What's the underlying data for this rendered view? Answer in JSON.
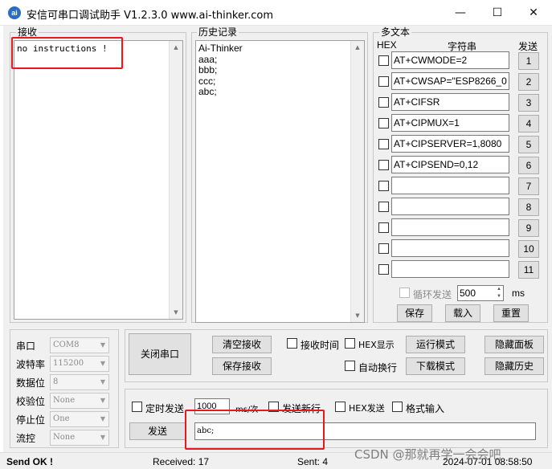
{
  "window": {
    "title": "安信可串口调试助手 V1.2.3.0     www.ai-thinker.com",
    "icon_text": "ai",
    "minimize": "—",
    "maximize": "☐",
    "close": "✕"
  },
  "receive": {
    "label": "接收",
    "text": "no instructions !"
  },
  "history": {
    "label": "历史记录",
    "lines": [
      "Ai-Thinker",
      "aaa;",
      "bbb;",
      "ccc;",
      "abc;"
    ]
  },
  "multitext": {
    "label": "多文本",
    "col_hex": "HEX",
    "col_string": "字符串",
    "col_send": "发送",
    "rows": [
      {
        "value": "AT+CWMODE=2",
        "num": "1"
      },
      {
        "value": "AT+CWSAP=\"ESP8266_0",
        "num": "2"
      },
      {
        "value": "AT+CIFSR",
        "num": "3"
      },
      {
        "value": "AT+CIPMUX=1",
        "num": "4"
      },
      {
        "value": "AT+CIPSERVER=1,8080",
        "num": "5"
      },
      {
        "value": "AT+CIPSEND=0,12",
        "num": "6"
      },
      {
        "value": "",
        "num": "7"
      },
      {
        "value": "",
        "num": "8"
      },
      {
        "value": "",
        "num": "9"
      },
      {
        "value": "",
        "num": "10"
      },
      {
        "value": "",
        "num": "11"
      }
    ],
    "loop_label": "循环发送",
    "loop_value": "500",
    "loop_unit": "ms",
    "save": "保存",
    "load": "载入",
    "reset": "重置"
  },
  "serial": {
    "port_label": "串口",
    "port_value": "COM8",
    "baud_label": "波特率",
    "baud_value": "115200",
    "databits_label": "数据位",
    "databits_value": "8",
    "parity_label": "校验位",
    "parity_value": "None",
    "stopbits_label": "停止位",
    "stopbits_value": "One",
    "flow_label": "流控",
    "flow_value": "None"
  },
  "controls": {
    "close_port": "关闭串口",
    "clear_receive": "清空接收",
    "save_receive": "保存接收",
    "recv_time": "接收时间",
    "hex_display": "HEX显示",
    "auto_wrap": "自动换行",
    "run_mode": "运行模式",
    "download_mode": "下载模式",
    "hide_panel": "隐藏面板",
    "hide_history": "隐藏历史"
  },
  "send": {
    "timed_send": "定时发送",
    "interval": "1000",
    "unit": "ms/次",
    "send_newline": "发送新行",
    "hex_send": "HEX发送",
    "format_input": "格式输入",
    "send_button": "发送",
    "input_value": "abc;"
  },
  "status": {
    "state": "Send OK !",
    "received": "Received: 17",
    "sent": "Sent: 4",
    "timestamp": "2024-07-01 08:58:50",
    "watermark": "CSDN @那就再学一会会吧"
  },
  "accent_colors": {
    "highlight": "#e8191c",
    "icon": "#2b6cc4"
  }
}
